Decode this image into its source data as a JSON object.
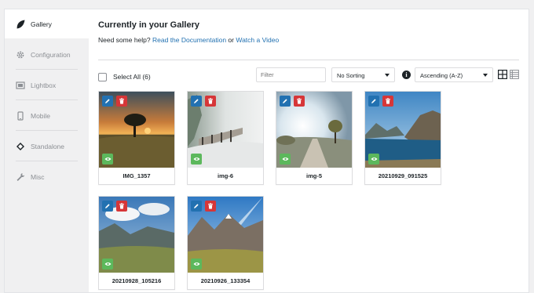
{
  "sidebar": {
    "items": [
      {
        "label": "Gallery",
        "icon": "leaf-icon",
        "active": true
      },
      {
        "label": "Configuration",
        "icon": "gear-icon",
        "active": false
      },
      {
        "label": "Lightbox",
        "icon": "lightbox-icon",
        "active": false
      },
      {
        "label": "Mobile",
        "icon": "mobile-icon",
        "active": false
      },
      {
        "label": "Standalone",
        "icon": "diamond-icon",
        "active": false
      },
      {
        "label": "Misc",
        "icon": "wrench-icon",
        "active": false
      }
    ]
  },
  "main": {
    "title": "Currently in your Gallery",
    "help_prefix": "Need some help?",
    "help_link_docs": "Read the Documentation",
    "help_or": "or",
    "help_link_video": "Watch a Video"
  },
  "toolbar": {
    "select_all_label": "Select All (6)",
    "filter_placeholder": "Filter",
    "sorting_value": "No Sorting",
    "order_value": "Ascending (A-Z)",
    "info_icon": "info-icon",
    "grid_view_icon": "grid-view-icon",
    "list_view_icon": "list-view-icon"
  },
  "gallery": {
    "images": [
      {
        "caption": "IMG_1357"
      },
      {
        "caption": "img-6"
      },
      {
        "caption": "img-5"
      },
      {
        "caption": "20210929_091525"
      },
      {
        "caption": "20210928_105216"
      },
      {
        "caption": "20210926_133354"
      }
    ]
  },
  "colors": {
    "accent_blue": "#2271b1",
    "delete_red": "#d63638",
    "view_green": "#5cb85c"
  }
}
